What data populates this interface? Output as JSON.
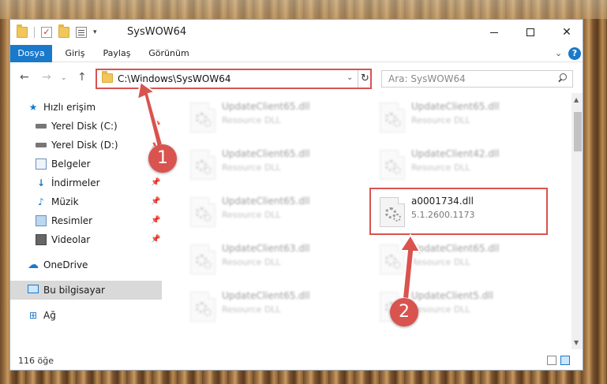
{
  "window": {
    "title": "SysWOW64",
    "close_symbol": "✕",
    "qa_check": "✓",
    "qa_dropdown": "▾"
  },
  "ribbon": {
    "tabs": [
      "Dosya",
      "Giriş",
      "Paylaş",
      "Görünüm"
    ],
    "help": "?",
    "expand": "⌄"
  },
  "nav": {
    "back": "←",
    "forward": "→",
    "recent": "⌄",
    "up": "↑",
    "address": "C:\\Windows\\SysWOW64",
    "address_dropdown": "⌄",
    "refresh": "↻",
    "search_placeholder": "Ara: SysWOW64"
  },
  "sidebar": {
    "items": [
      {
        "label": "Hızlı erişim",
        "icon": "star-icon",
        "glyph": "★"
      },
      {
        "label": "Yerel Disk (C:)",
        "icon": "disk-icon",
        "pin": "📌"
      },
      {
        "label": "Yerel Disk (D:)",
        "icon": "disk-icon",
        "pin": "📌"
      },
      {
        "label": "Belgeler",
        "icon": "document-icon",
        "pin": "📌"
      },
      {
        "label": "İndirmeler",
        "icon": "download-icon",
        "glyph": "↓",
        "pin": "📌"
      },
      {
        "label": "Müzik",
        "icon": "music-icon",
        "glyph": "♪",
        "pin": "📌"
      },
      {
        "label": "Resimler",
        "icon": "picture-icon",
        "pin": "📌"
      },
      {
        "label": "Videolar",
        "icon": "video-icon",
        "pin": "📌"
      },
      {
        "label": "OneDrive",
        "icon": "cloud-icon",
        "glyph": "☁"
      },
      {
        "label": "Bu bilgisayar",
        "icon": "computer-icon",
        "selected": true
      },
      {
        "label": "Ağ",
        "icon": "network-icon",
        "glyph": "⊞"
      }
    ]
  },
  "files": [
    {
      "name": "UpdateClient65.dll",
      "desc": "Resource DLL"
    },
    {
      "name": "UpdateClient65.dll",
      "desc": "Resource DLL"
    },
    {
      "name": "UpdateClient65.dll",
      "desc": "Resource DLL"
    },
    {
      "name": "UpdateClient42.dll",
      "desc": "Resource DLL"
    },
    {
      "name": "UpdateClient65.dll",
      "desc": "Resource DLL"
    },
    {
      "name": "a0001734.dll",
      "desc": "5.1.2600.1173"
    },
    {
      "name": "UpdateClient63.dll",
      "desc": "Resource DLL"
    },
    {
      "name": "UpdateClient65.dll",
      "desc": "Resource DLL"
    },
    {
      "name": "UpdateClient65.dll",
      "desc": "Resource DLL"
    },
    {
      "name": "UpdateClient5.dll",
      "desc": "Resource DLL"
    }
  ],
  "status": {
    "count": "116 öğe"
  },
  "annotations": {
    "step1": "1",
    "step2": "2",
    "color": "#d9534f"
  },
  "colors": {
    "accent": "#1979ca",
    "highlight": "#d9534f"
  }
}
